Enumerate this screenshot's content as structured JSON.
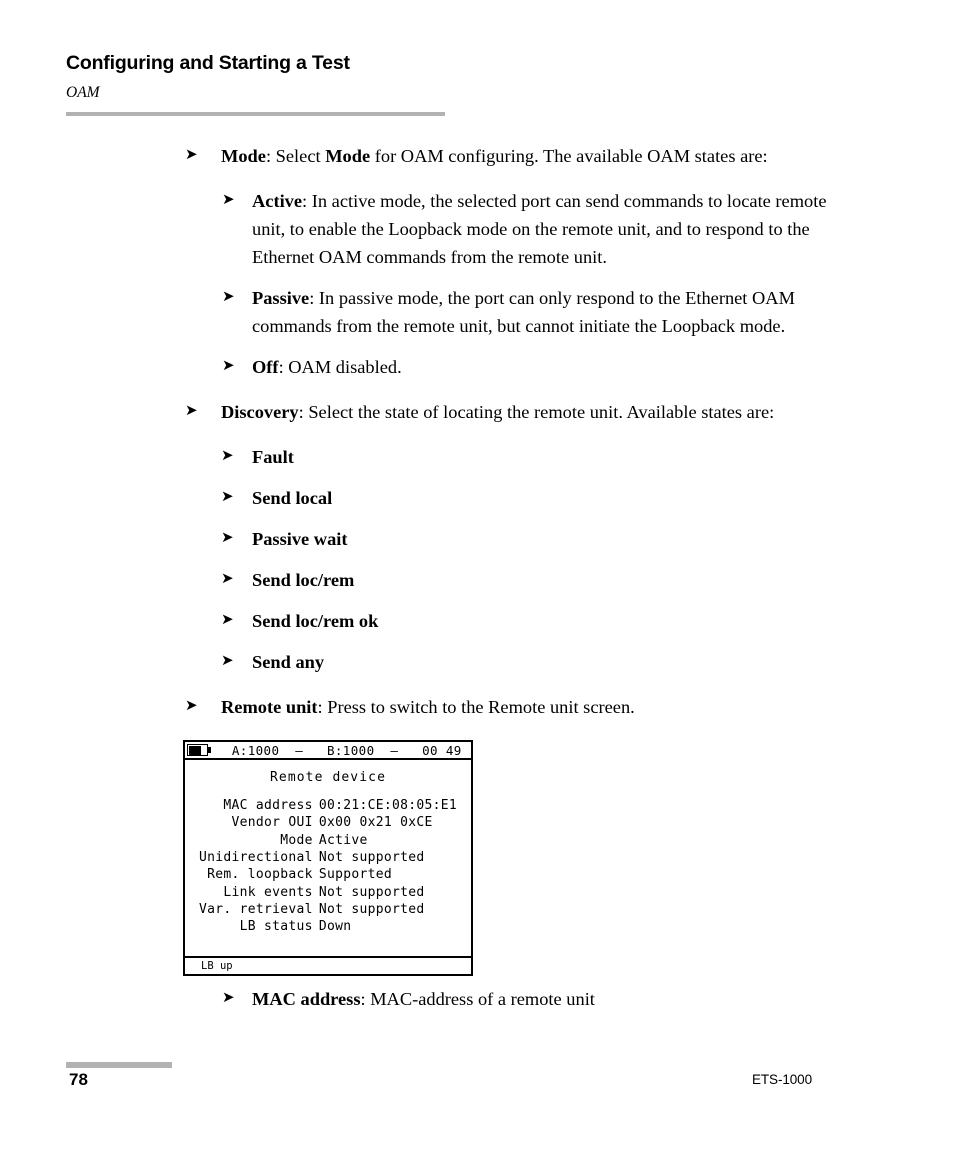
{
  "header": {
    "title": "Configuring and Starting a Test",
    "subtitle": "OAM"
  },
  "bullet_glyph": "➤",
  "content": {
    "mode": {
      "term": "Mode",
      "text_before_bold": ": Select ",
      "inline_bold": "Mode",
      "text_after_bold": " for OAM configuring. The available OAM states are:"
    },
    "mode_states": [
      {
        "term": "Active",
        "text": ": In active mode, the selected port can send commands to locate remote unit, to enable the Loopback mode on the remote unit, and to respond to the Ethernet OAM commands from the remote unit."
      },
      {
        "term": "Passive",
        "text": ": In passive mode, the port can only respond to the Ethernet OAM commands from the remote unit, but cannot initiate the Loopback mode."
      },
      {
        "term": "Off",
        "text": ": OAM disabled."
      }
    ],
    "discovery": {
      "term": "Discovery",
      "text": ": Select the state of locating the remote unit. Available states are:"
    },
    "discovery_states": [
      "Fault",
      "Send local",
      "Passive wait",
      "Send loc/rem",
      "Send loc/rem ok",
      "Send any"
    ],
    "remote_unit": {
      "term": "Remote unit",
      "text": ": Press to switch to the Remote unit screen."
    },
    "mac_address": {
      "term": "MAC address",
      "text": ": MAC-address of a remote unit"
    }
  },
  "lcd": {
    "status_bar": {
      "battery_icon": "battery-icon",
      "text": "  A:1000  –   B:1000  –   00 49"
    },
    "screen_title": "Remote device",
    "rows": [
      {
        "label": "MAC address",
        "value": "00:21:CE:08:05:E1"
      },
      {
        "label": "Vendor OUI",
        "value": "0x00 0x21 0xCE"
      },
      {
        "label": "Mode",
        "value": "Active"
      },
      {
        "label": "Unidirectional",
        "value": "Not supported"
      },
      {
        "label": "Rem. loopback",
        "value": "Supported"
      },
      {
        "label": "Link events",
        "value": "Not supported"
      },
      {
        "label": "Var. retrieval",
        "value": "Not supported"
      },
      {
        "label": "LB status",
        "value": "Down"
      }
    ],
    "footer": "LB up"
  },
  "footer": {
    "page_number": "78",
    "product": "ETS-1000"
  }
}
